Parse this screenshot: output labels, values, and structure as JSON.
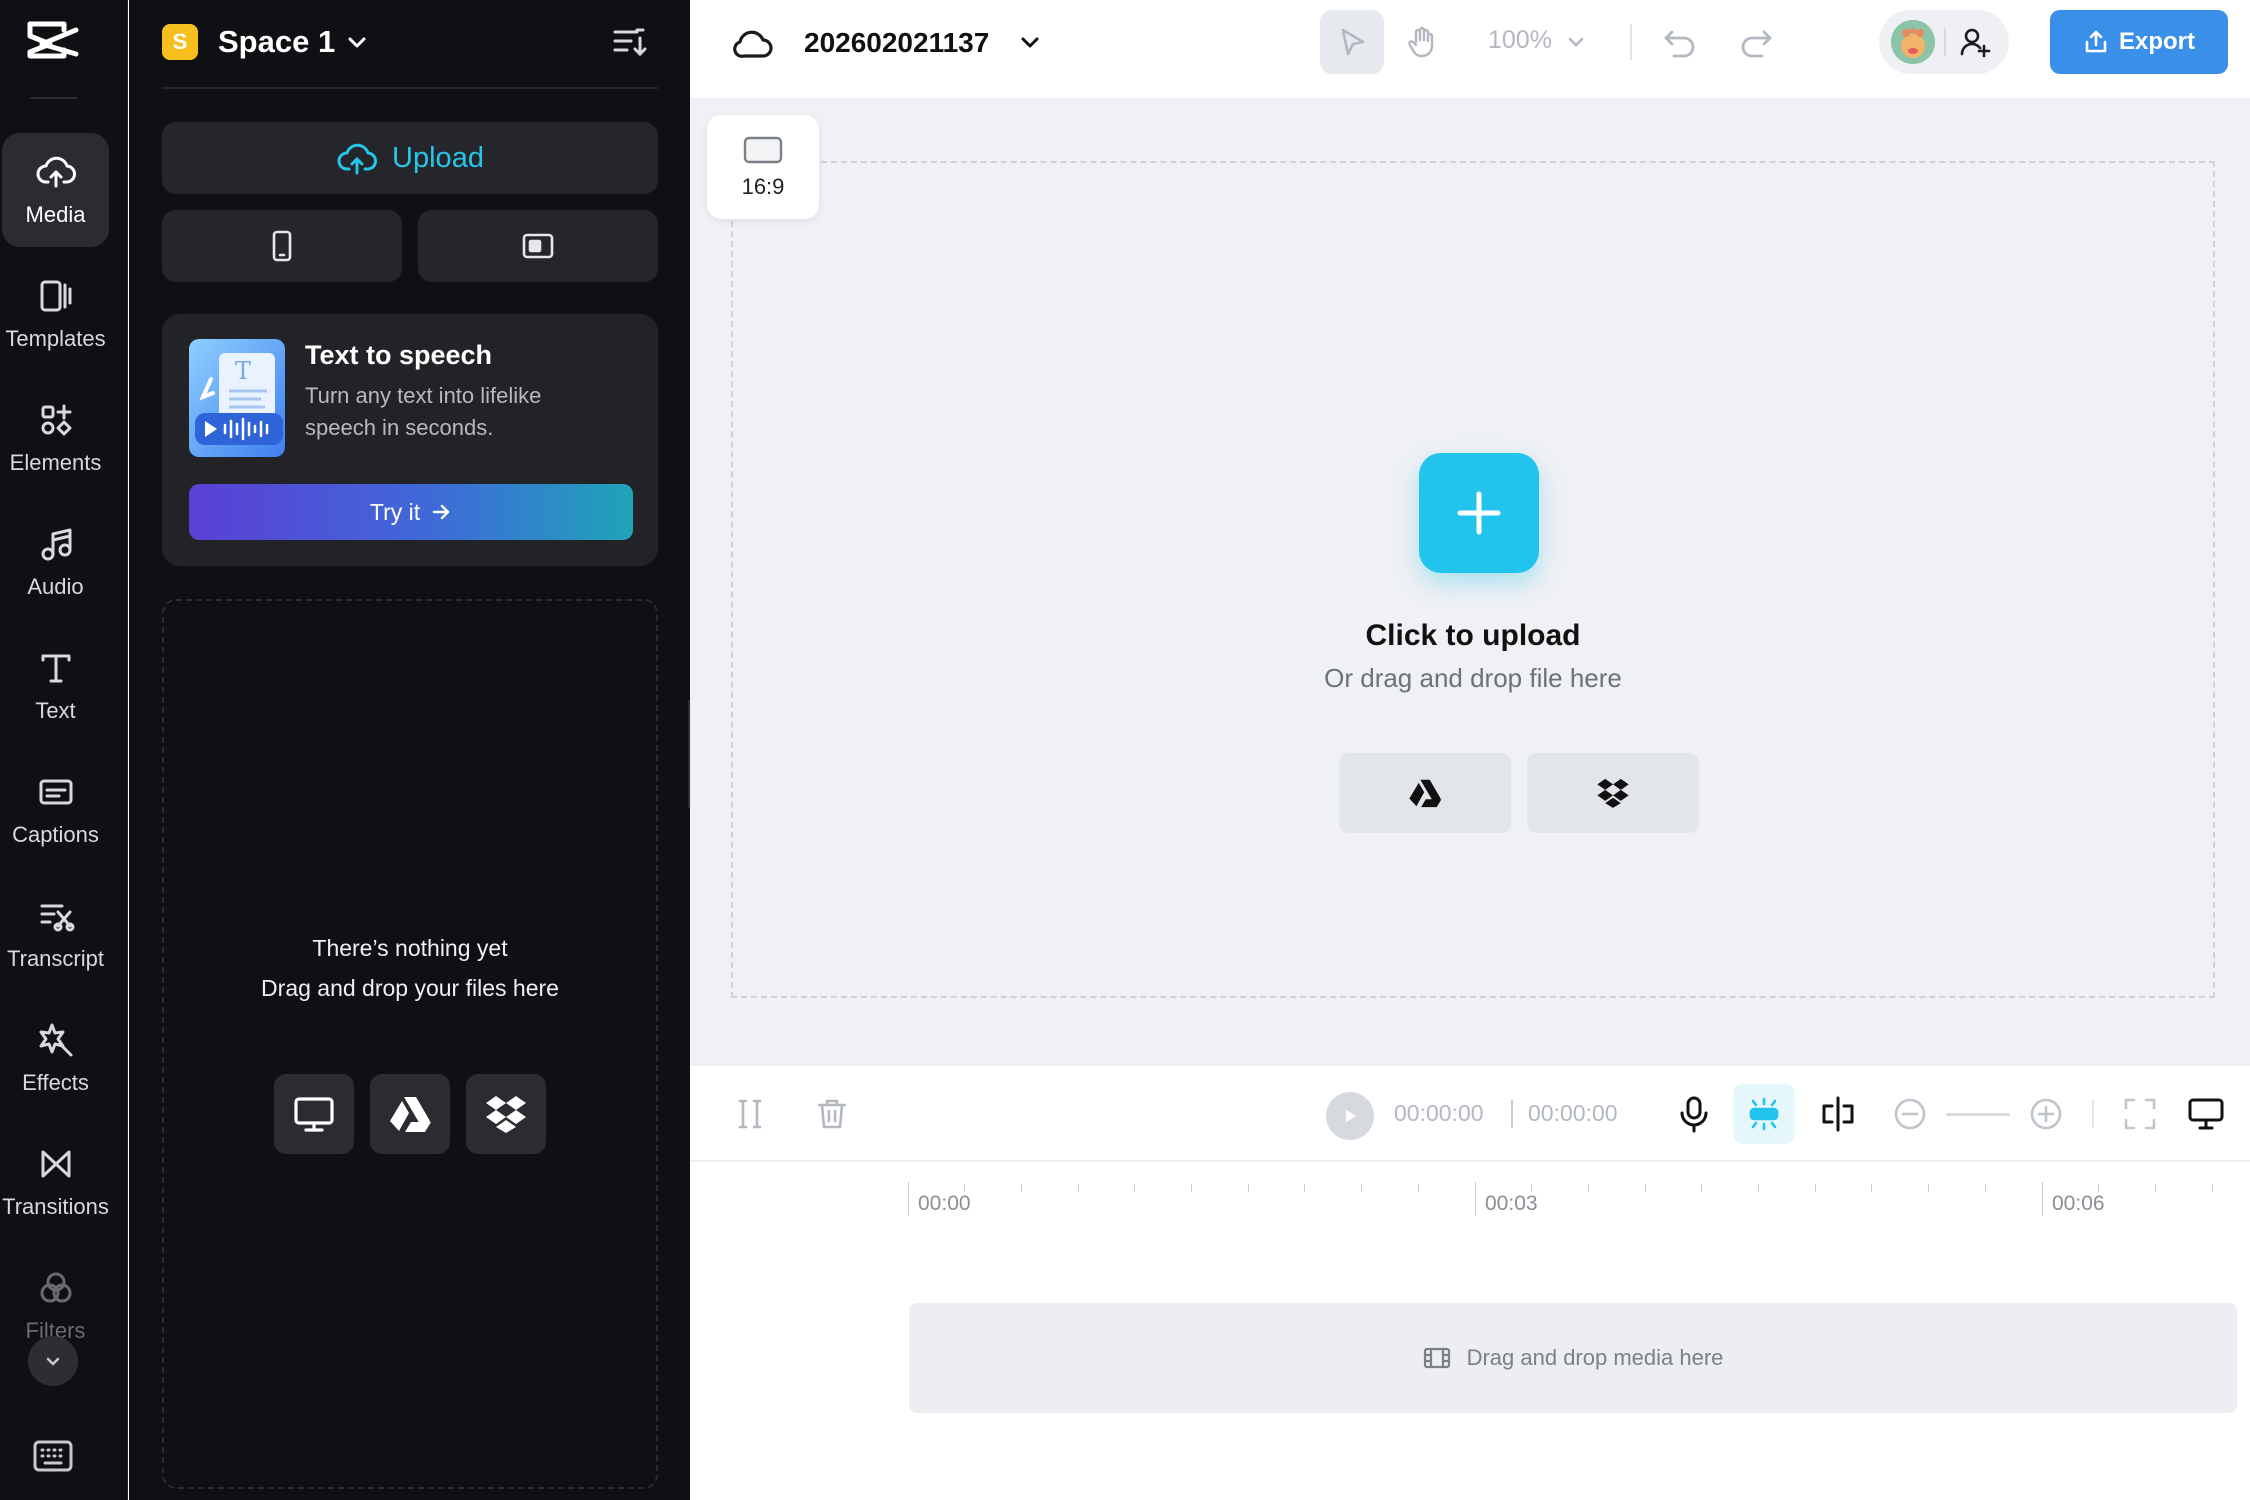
{
  "rail": {
    "items": [
      {
        "label": "Media",
        "icon": "cloud-upload-icon"
      },
      {
        "label": "Templates",
        "icon": "templates-icon"
      },
      {
        "label": "Elements",
        "icon": "elements-icon"
      },
      {
        "label": "Audio",
        "icon": "music-note-icon"
      },
      {
        "label": "Text",
        "icon": "text-icon"
      },
      {
        "label": "Captions",
        "icon": "captions-icon"
      },
      {
        "label": "Transcript",
        "icon": "transcript-icon"
      },
      {
        "label": "Effects",
        "icon": "effects-icon"
      },
      {
        "label": "Transitions",
        "icon": "transitions-icon"
      },
      {
        "label": "Filters",
        "icon": "filters-icon"
      }
    ]
  },
  "space": {
    "badge": "S",
    "name": "Space 1"
  },
  "panel": {
    "upload_label": "Upload",
    "tts": {
      "title": "Text to speech",
      "description": "Turn any text into lifelike speech in seconds.",
      "cta": "Try it"
    },
    "dropzone": {
      "line1": "There’s nothing yet",
      "line2": "Drag and drop your files here"
    }
  },
  "topbar": {
    "project_name": "202602021137",
    "zoom": "100%",
    "export_label": "Export"
  },
  "canvas": {
    "aspect_ratio": "16:9",
    "click_to_upload": "Click to upload",
    "drag_hint": "Or drag and drop file here"
  },
  "timeline": {
    "current_time": "00:00:00",
    "total_time": "00:00:00",
    "ruler_labels": [
      "00:00",
      "00:03",
      "00:06"
    ],
    "track_placeholder": "Drag and drop media here"
  },
  "colors": {
    "accent": "#22c3ec",
    "export": "#3a8fe8",
    "space_badge": "#f6bf1d",
    "panel_bg": "#0f1013"
  }
}
